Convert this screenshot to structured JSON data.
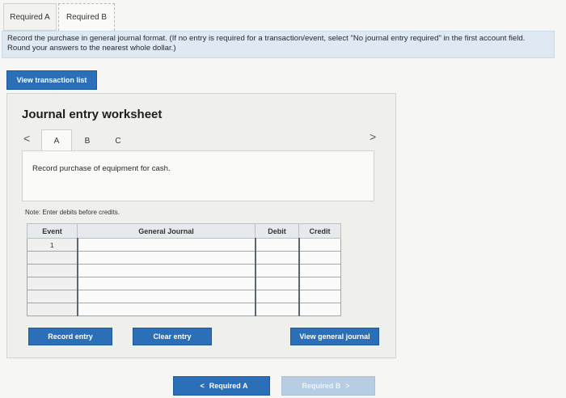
{
  "top_tabs": [
    {
      "label": "Required A"
    },
    {
      "label": "Required B"
    }
  ],
  "instruction": "Record the purchase in general journal format. (If no entry is required for a transaction/event, select \"No journal entry required\" in the first account field. Round your answers to the nearest whole dollar.)",
  "view_transaction_list": "View transaction list",
  "worksheet": {
    "title": "Journal entry worksheet",
    "prev_glyph": "<",
    "next_glyph": ">",
    "tabs": [
      "A",
      "B",
      "C"
    ],
    "description": "Record purchase of equipment for cash.",
    "note": "Note: Enter debits before credits.",
    "columns": [
      "Event",
      "General Journal",
      "Debit",
      "Credit"
    ],
    "rows": [
      {
        "event": "1",
        "account": "",
        "debit": "",
        "credit": ""
      },
      {
        "event": "",
        "account": "",
        "debit": "",
        "credit": ""
      },
      {
        "event": "",
        "account": "",
        "debit": "",
        "credit": ""
      },
      {
        "event": "",
        "account": "",
        "debit": "",
        "credit": ""
      },
      {
        "event": "",
        "account": "",
        "debit": "",
        "credit": ""
      },
      {
        "event": "",
        "account": "",
        "debit": "",
        "credit": ""
      }
    ],
    "record_entry": "Record entry",
    "clear_entry": "Clear entry",
    "view_general_journal": "View general journal"
  },
  "nav": {
    "required_a": "Required A",
    "required_b": "Required B",
    "prev_chevron": "<",
    "next_chevron": ">"
  },
  "colors": {
    "accent": "#2b6fb8",
    "instruction_bg": "#dfe9f3",
    "disabled_button": "#b7cde4"
  }
}
